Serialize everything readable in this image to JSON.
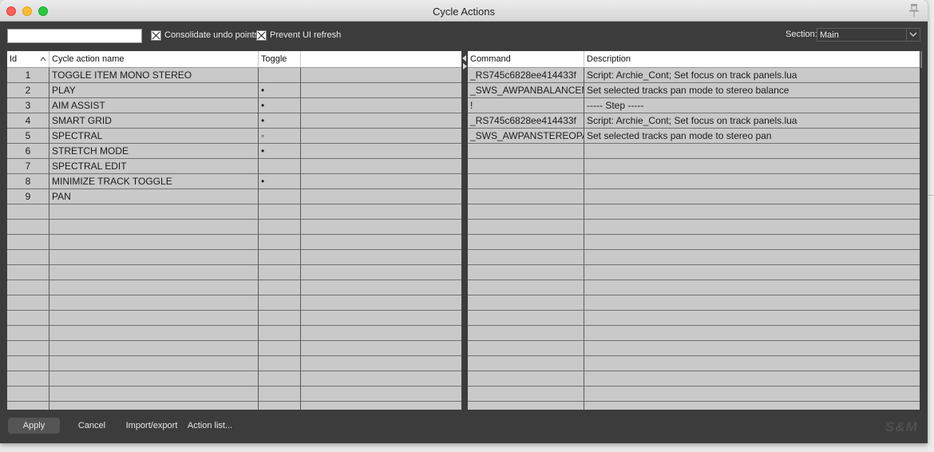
{
  "window": {
    "title": "Cycle Actions"
  },
  "toolbar": {
    "search_value": "",
    "consolidate_label": "Consolidate undo points",
    "prevent_refresh_label": "Prevent UI refresh",
    "section_label": "Section:",
    "section_value": "Main"
  },
  "left_list": {
    "headers": [
      "Id",
      "Cycle action name",
      "Toggle",
      ""
    ],
    "rows": [
      {
        "id": "1",
        "name": "TOGGLE ITEM MONO STEREO",
        "toggle": ""
      },
      {
        "id": "2",
        "name": "PLAY",
        "toggle": "•"
      },
      {
        "id": "3",
        "name": "AIM ASSIST",
        "toggle": "•"
      },
      {
        "id": "4",
        "name": "SMART GRID",
        "toggle": "•"
      },
      {
        "id": "5",
        "name": "SPECTRAL",
        "toggle": "◦"
      },
      {
        "id": "6",
        "name": "STRETCH MODE",
        "toggle": "•"
      },
      {
        "id": "7",
        "name": "SPECTRAL EDIT",
        "toggle": ""
      },
      {
        "id": "8",
        "name": "MINIMIZE TRACK TOGGLE",
        "toggle": "•"
      },
      {
        "id": "9",
        "name": "PAN",
        "toggle": ""
      }
    ]
  },
  "right_list": {
    "headers": [
      "Command",
      "Description"
    ],
    "rows": [
      {
        "command": "_RS745c6828ee414433f",
        "description": "Script: Archie_Cont; Set focus on track panels.lua"
      },
      {
        "command": "_SWS_AWPANBALANCEM",
        "description": "Set selected tracks pan mode to stereo balance"
      },
      {
        "command": "!",
        "description": "----- Step -----"
      },
      {
        "command": "_RS745c6828ee414433f",
        "description": "Script: Archie_Cont; Set focus on track panels.lua"
      },
      {
        "command": "_SWS_AWPANSTEREOPA",
        "description": "Set selected tracks pan mode to stereo pan"
      }
    ]
  },
  "buttons": {
    "apply": "Apply",
    "cancel": "Cancel",
    "import_export": "Import/export",
    "action_list": "Action list..."
  },
  "brand": "S&M",
  "colors": {
    "window_bg": "#3c3c3c",
    "row_bg": "#c9c9c9",
    "header_bg": "#ffffff",
    "grid_line": "#727272",
    "label_text": "#e9e9e9"
  }
}
